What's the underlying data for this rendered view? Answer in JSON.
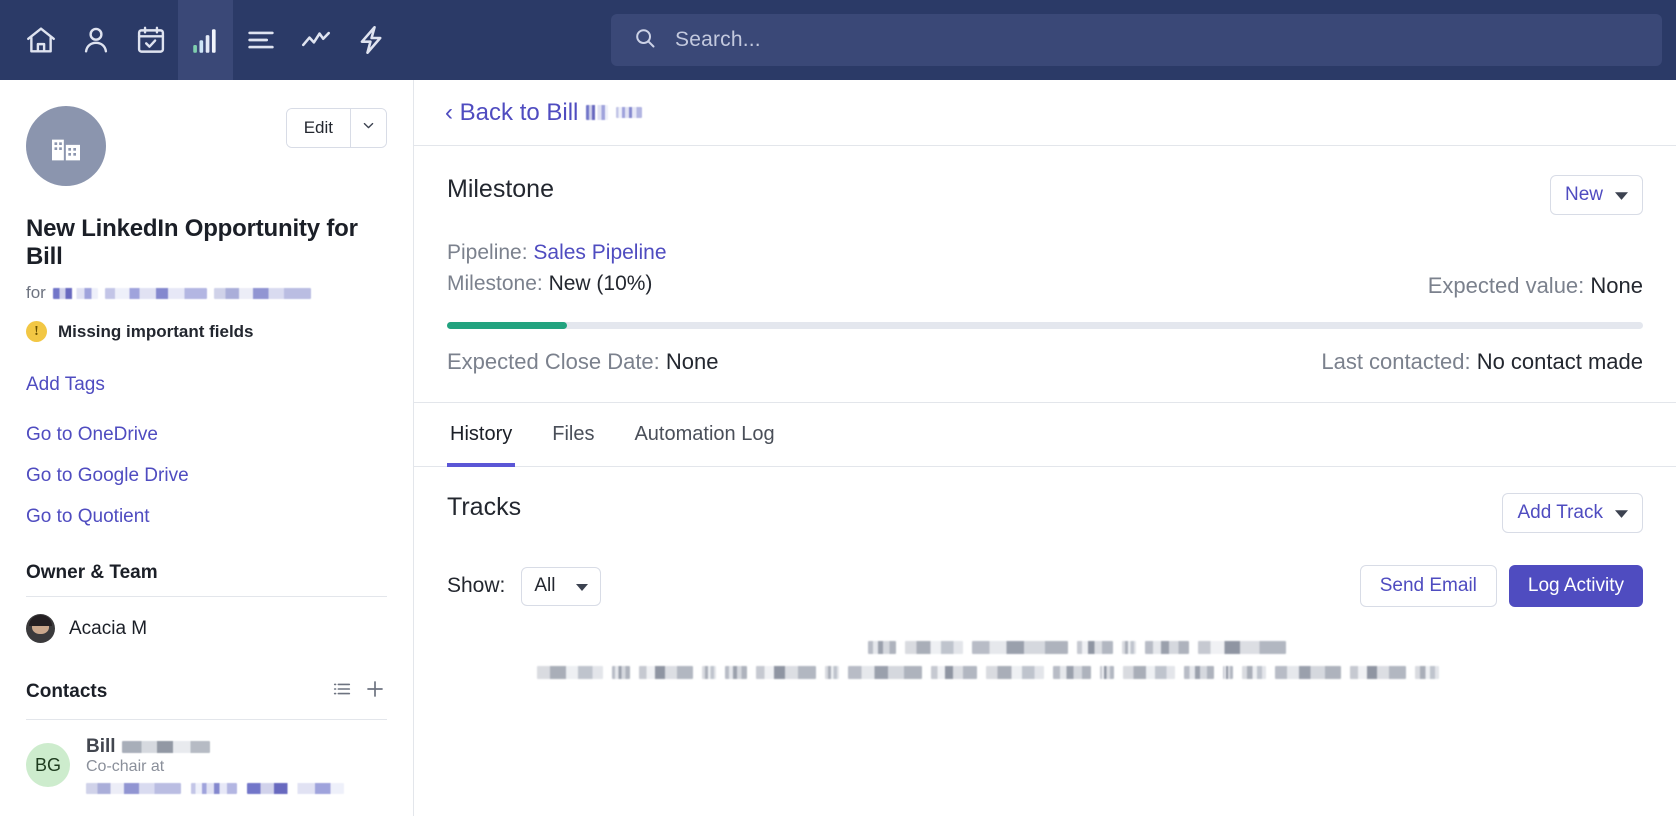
{
  "topnav": {
    "icons": [
      {
        "name": "home-icon",
        "label": "Home",
        "active": false
      },
      {
        "name": "person-icon",
        "label": "Contacts",
        "active": false
      },
      {
        "name": "calendar-check-icon",
        "label": "Calendar",
        "active": false
      },
      {
        "name": "bar-chart-icon",
        "label": "Pipeline",
        "active": true
      },
      {
        "name": "list-icon",
        "label": "Tasks",
        "active": false
      },
      {
        "name": "trend-line-icon",
        "label": "Reports",
        "active": false
      },
      {
        "name": "lightning-icon",
        "label": "Automations",
        "active": false
      }
    ],
    "search": {
      "placeholder": "Search...",
      "icon": "search-icon"
    }
  },
  "sidebar": {
    "avatar_icon": "company-building-icon",
    "edit_button": "Edit",
    "edit_caret_icon": "chevron-down-icon",
    "opportunity_title": "New LinkedIn Opportunity for Bill",
    "for_label": "for",
    "for_value_redacted": true,
    "warning": {
      "icon": "exclamation-circle-icon",
      "text": "Missing important fields"
    },
    "add_tags": "Add Tags",
    "links": [
      "Go to OneDrive",
      "Go to Google Drive",
      "Go to Quotient"
    ],
    "owner_team": {
      "heading": "Owner & Team",
      "owner_name": "Acacia M",
      "owner_avatar": "user-photo-avatar"
    },
    "contacts": {
      "heading": "Contacts",
      "list_icon": "list-view-icon",
      "add_icon": "plus-icon",
      "items": [
        {
          "initials": "BG",
          "name": "Bill",
          "name_redacted": true,
          "subtitle": "Co-chair at",
          "subtitle_redacted": true
        }
      ]
    }
  },
  "main": {
    "breadcrumb": {
      "chevron": "‹",
      "text": "Back to Bill",
      "redacted": true
    },
    "milestone": {
      "title": "Milestone",
      "stage_button": "New",
      "stage_caret_icon": "caret-down-icon",
      "pipeline_key": "Pipeline:",
      "pipeline_value": "Sales Pipeline",
      "milestone_key": "Milestone:",
      "milestone_value": "New (10%)",
      "expected_value_key": "Expected value:",
      "expected_value": "None",
      "progress_percent": 10,
      "progress_color": "#22a37f",
      "expected_close_key": "Expected Close Date:",
      "expected_close_value": "None",
      "last_contacted_key": "Last contacted:",
      "last_contacted_value": "No contact made"
    },
    "tabs": [
      {
        "label": "History",
        "active": true
      },
      {
        "label": "Files",
        "active": false
      },
      {
        "label": "Automation Log",
        "active": false
      }
    ],
    "tracks": {
      "title": "Tracks",
      "add_track_button": "Add Track",
      "add_track_caret_icon": "caret-down-icon",
      "show_label": "Show:",
      "show_value": "All",
      "show_caret_icon": "caret-down-icon",
      "send_email_button": "Send Email",
      "log_activity_button": "Log Activity"
    }
  },
  "colors": {
    "nav_bg": "#2b3a67",
    "nav_active": "#3a4877",
    "accent": "#4f4cc0",
    "tab_underline": "#5b56d6",
    "progress": "#22a37f",
    "warning": "#f2c744",
    "contact_avatar_bg": "#cdeccd"
  }
}
